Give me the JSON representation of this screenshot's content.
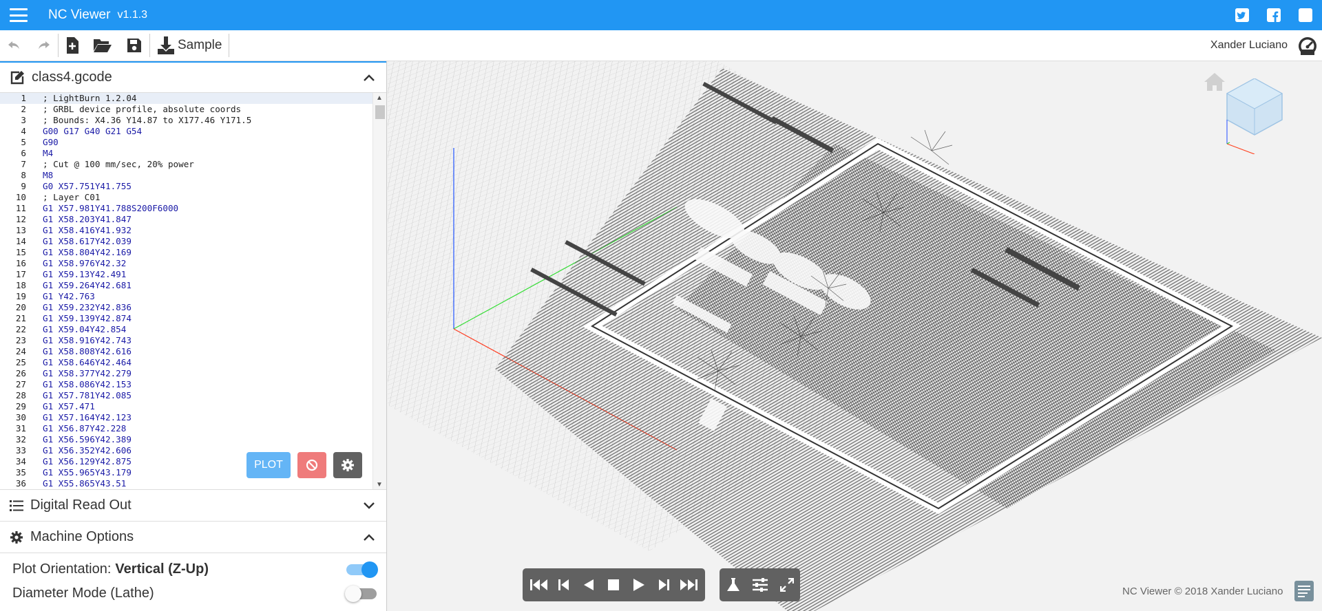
{
  "topbar": {
    "title": "NC Viewer",
    "version": "v1.1.3",
    "social": [
      "twitter-icon",
      "facebook-icon",
      "instagram-icon"
    ]
  },
  "toolbar": {
    "sample_label": "Sample",
    "user": "Xander Luciano"
  },
  "editor": {
    "filename": "class4.gcode",
    "lines": [
      {
        "n": "1",
        "t": "; LightBurn 1.2.04"
      },
      {
        "n": "2",
        "t": "; GRBL device profile, absolute coords"
      },
      {
        "n": "3",
        "t": "; Bounds: X4.36 Y14.87 to X177.46 Y171.5"
      },
      {
        "n": "4",
        "t": "G00 G17 G40 G21 G54"
      },
      {
        "n": "5",
        "t": "G90"
      },
      {
        "n": "6",
        "t": "M4"
      },
      {
        "n": "7",
        "t": "; Cut @ 100 mm/sec, 20% power"
      },
      {
        "n": "8",
        "t": "M8"
      },
      {
        "n": "9",
        "t": "G0 X57.751Y41.755"
      },
      {
        "n": "10",
        "t": "; Layer C01"
      },
      {
        "n": "11",
        "t": "G1 X57.981Y41.788S200F6000"
      },
      {
        "n": "12",
        "t": "G1 X58.203Y41.847"
      },
      {
        "n": "13",
        "t": "G1 X58.416Y41.932"
      },
      {
        "n": "14",
        "t": "G1 X58.617Y42.039"
      },
      {
        "n": "15",
        "t": "G1 X58.804Y42.169"
      },
      {
        "n": "16",
        "t": "G1 X58.976Y42.32"
      },
      {
        "n": "17",
        "t": "G1 X59.13Y42.491"
      },
      {
        "n": "18",
        "t": "G1 X59.264Y42.681"
      },
      {
        "n": "19",
        "t": "G1 Y42.763"
      },
      {
        "n": "20",
        "t": "G1 X59.232Y42.836"
      },
      {
        "n": "21",
        "t": "G1 X59.139Y42.874"
      },
      {
        "n": "22",
        "t": "G1 X59.04Y42.854"
      },
      {
        "n": "23",
        "t": "G1 X58.916Y42.743"
      },
      {
        "n": "24",
        "t": "G1 X58.808Y42.616"
      },
      {
        "n": "25",
        "t": "G1 X58.646Y42.464"
      },
      {
        "n": "26",
        "t": "G1 X58.377Y42.279"
      },
      {
        "n": "27",
        "t": "G1 X58.086Y42.153"
      },
      {
        "n": "28",
        "t": "G1 X57.781Y42.085"
      },
      {
        "n": "29",
        "t": "G1 X57.471"
      },
      {
        "n": "30",
        "t": "G1 X57.164Y42.123"
      },
      {
        "n": "31",
        "t": "G1 X56.87Y42.228"
      },
      {
        "n": "32",
        "t": "G1 X56.596Y42.389"
      },
      {
        "n": "33",
        "t": "G1 X56.352Y42.606"
      },
      {
        "n": "34",
        "t": "G1 X56.129Y42.875"
      },
      {
        "n": "35",
        "t": "G1 X55.965Y43.179"
      },
      {
        "n": "36",
        "t": "G1 X55.865Y43.51"
      }
    ],
    "plot_label": "PLOT"
  },
  "panels": {
    "dro": "Digital Read Out",
    "machine": "Machine Options"
  },
  "options": {
    "plot_orientation_label": "Plot Orientation:",
    "plot_orientation_value": "Vertical (Z-Up)",
    "plot_orientation_on": true,
    "diameter_label": "Diameter Mode (Lathe)",
    "diameter_on": false
  },
  "footer": {
    "copyright": "NC Viewer © 2018 Xander Luciano"
  },
  "colors": {
    "accent": "#2196f3",
    "x_axis": "#ff3b1f",
    "y_axis": "#33dd33",
    "z_axis": "#2255ff"
  }
}
